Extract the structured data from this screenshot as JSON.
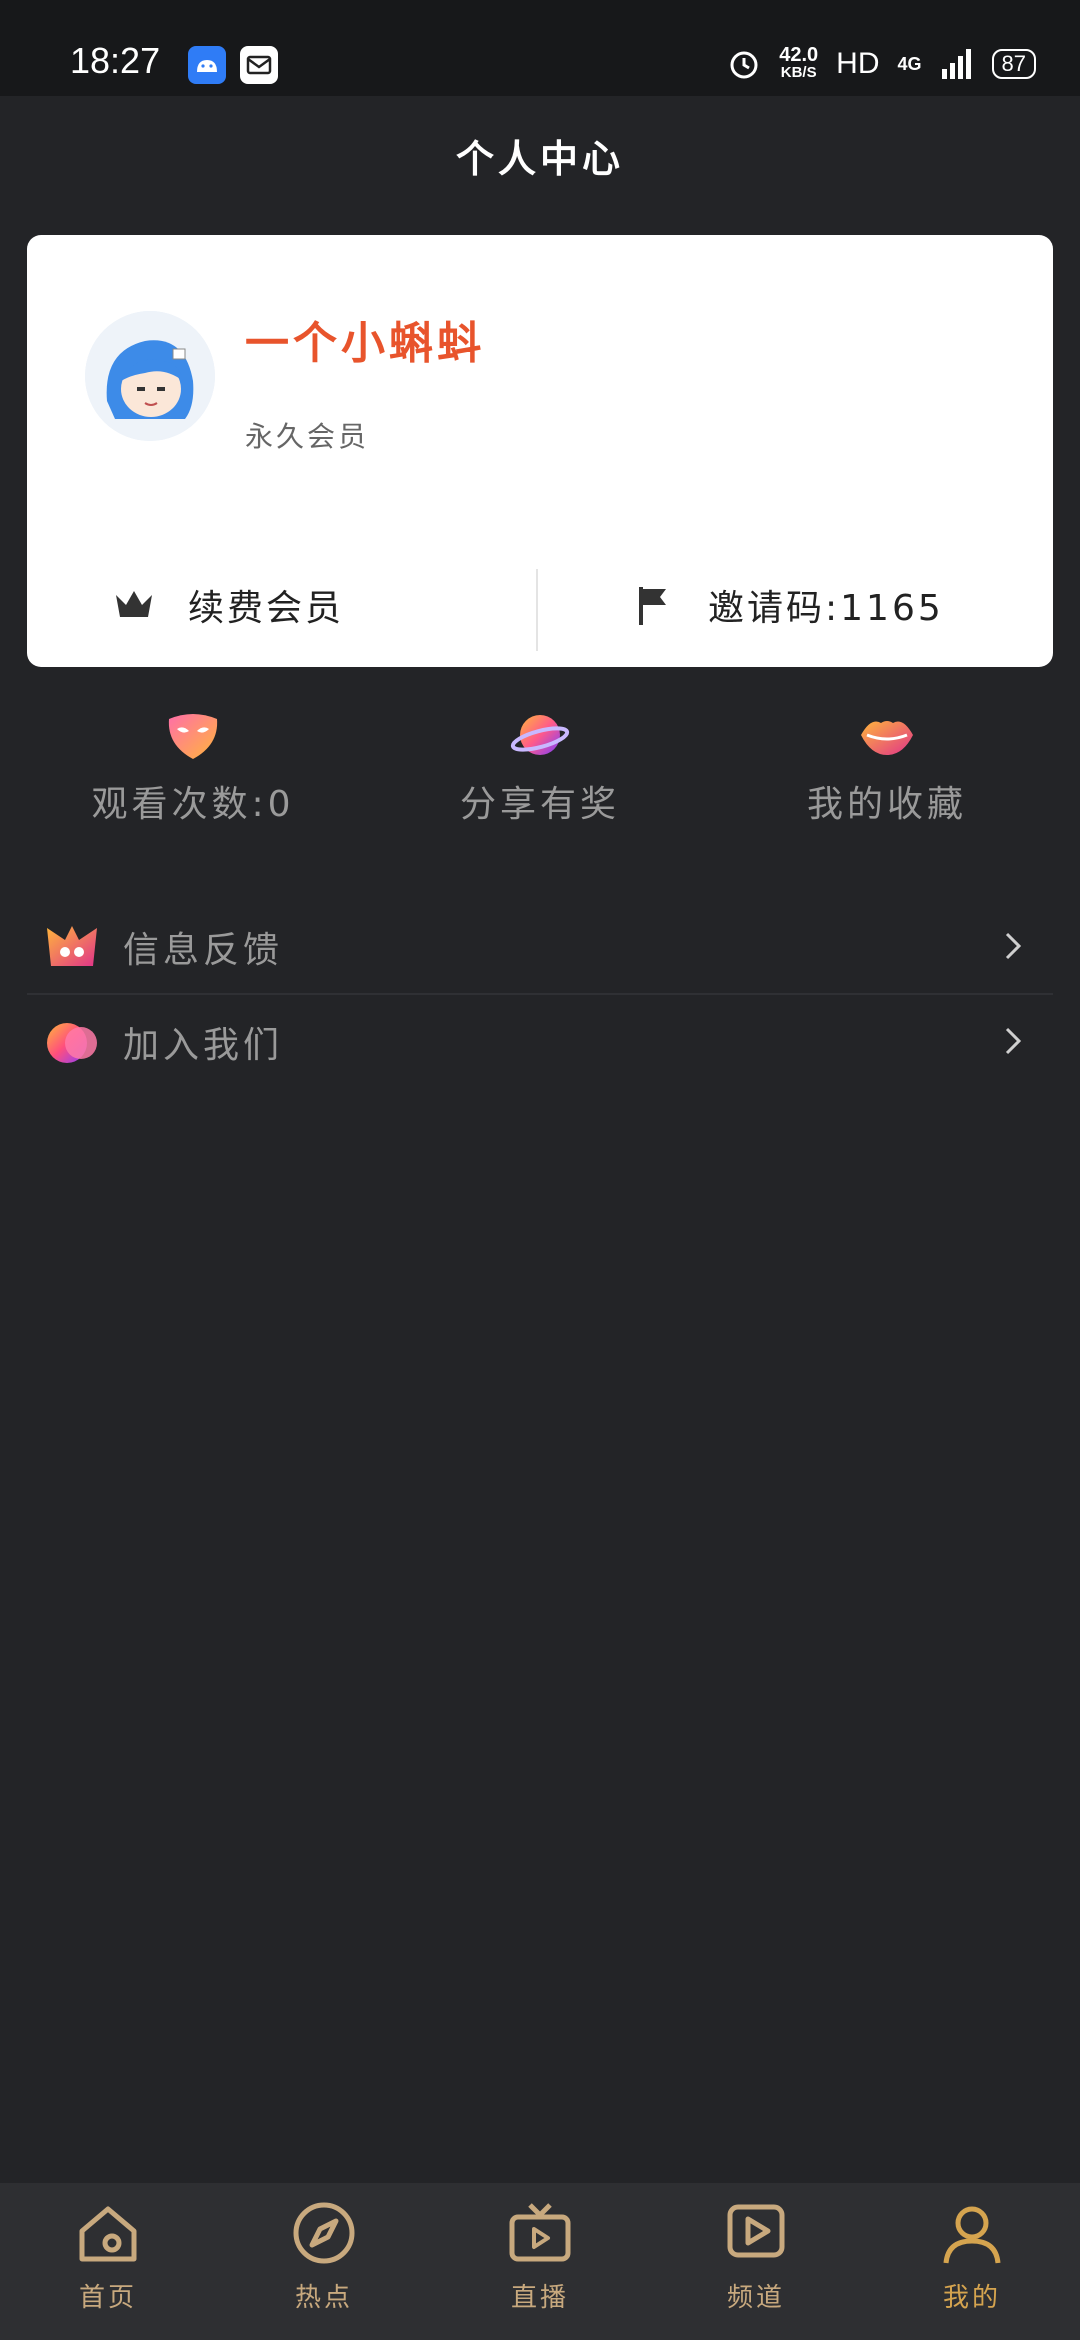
{
  "status_bar": {
    "time": "18:27",
    "net_speed": "42.0",
    "net_speed_unit": "KB/S",
    "hd": "HD",
    "network": "4G",
    "battery": "87",
    "icons": [
      "android-icon",
      "mail-icon",
      "alarm-icon",
      "signal-icon"
    ]
  },
  "page": {
    "title": "个人中心"
  },
  "profile": {
    "username": "一个小蝌蚪",
    "level": "永久会员",
    "actions": {
      "renew": {
        "label": "续费会员",
        "icon": "crown-icon"
      },
      "invite": {
        "label": "邀请码:1165",
        "icon": "flag-icon"
      }
    }
  },
  "quick_links": [
    {
      "label": "观看次数:0",
      "icon": "mask-icon"
    },
    {
      "label": "分享有奖",
      "icon": "planet-icon"
    },
    {
      "label": "我的收藏",
      "icon": "lips-icon"
    }
  ],
  "menu": [
    {
      "label": "信息反馈",
      "icon": "feedback-icon"
    },
    {
      "label": "加入我们",
      "icon": "join-icon"
    }
  ],
  "tabbar": {
    "items": [
      {
        "label": "首页",
        "icon": "home-icon"
      },
      {
        "label": "热点",
        "icon": "compass-icon"
      },
      {
        "label": "直播",
        "icon": "tv-icon"
      },
      {
        "label": "频道",
        "icon": "play-icon"
      },
      {
        "label": "我的",
        "icon": "user-icon",
        "active": true
      }
    ]
  },
  "colors": {
    "background": "#232427",
    "card": "#ffffff",
    "username": "#e8542c",
    "tab_label": "#c8a97e",
    "tab_active": "#d5a44f",
    "muted_text": "#9a9a9a"
  }
}
